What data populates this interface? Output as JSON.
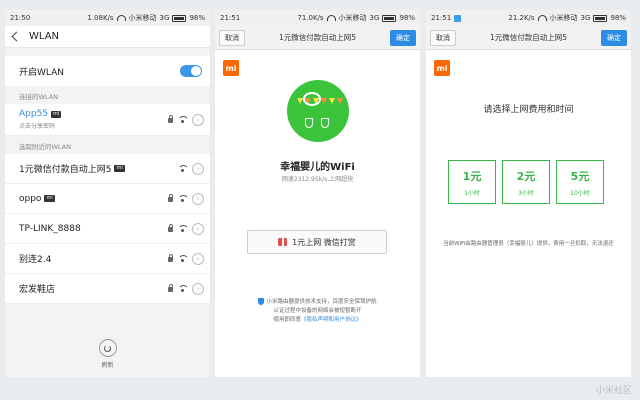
{
  "p1": {
    "status": {
      "time": "21:50",
      "speed": "1.08K/s",
      "carrier": "小米移动",
      "net": "3G",
      "battery": "98%"
    },
    "header_title": "WLAN",
    "toggle_label": "开启WLAN",
    "connected_title": "连接的WLAN",
    "connected": {
      "name": "App55",
      "badge": "mi",
      "sub": "点击分享密码"
    },
    "nearby_title": "选取附近的WLAN",
    "networks": [
      {
        "name": "1元微信付款自动上网5",
        "badge": "mi",
        "lock": false
      },
      {
        "name": "oppo",
        "badge": "mi",
        "lock": true
      },
      {
        "name": "TP-LINK_8888",
        "badge": "",
        "lock": true
      },
      {
        "name": "别连2.4",
        "badge": "",
        "lock": true
      },
      {
        "name": "宏发鞋店",
        "badge": "",
        "lock": true
      }
    ],
    "refresh_label": "刷新"
  },
  "p2": {
    "status": {
      "time": "21:51",
      "speed": "71.0K/s",
      "carrier": "小米移动",
      "net": "3G",
      "battery": "98%"
    },
    "cancel": "取消",
    "title": "1元微信付款自动上网5",
    "ok": "确定",
    "mi_logo": "mi",
    "shop_name": "幸福婴儿的WiFi",
    "shop_speed": "网速2312.95k/s,上网超快",
    "pay_label": "1元上网 微信打赏",
    "footer_1": "小米路由器提供技术支持，百度安全保驾护航",
    "footer_2": "认证过程中设备的网络会被短暂断开",
    "footer_3": "使用即同意",
    "footer_link": "《隐私声明和用户协议》"
  },
  "p3": {
    "status": {
      "time": "21:51",
      "speed": "21.2K/s",
      "carrier": "小米移动",
      "net": "3G",
      "battery": "98%"
    },
    "cancel": "取消",
    "title": "1元微信付款自动上网5",
    "ok": "确定",
    "mi_logo": "mi",
    "choose_title": "请选择上网费用和时间",
    "plans": [
      {
        "price": "1元",
        "duration": "1小时"
      },
      {
        "price": "2元",
        "duration": "3小时"
      },
      {
        "price": "5元",
        "duration": "10小时"
      }
    ],
    "note": "当前WiFi由路由器管理员（幸福婴儿）提供，费用一旦扣取，无法退还"
  },
  "watermark": "小米社区"
}
